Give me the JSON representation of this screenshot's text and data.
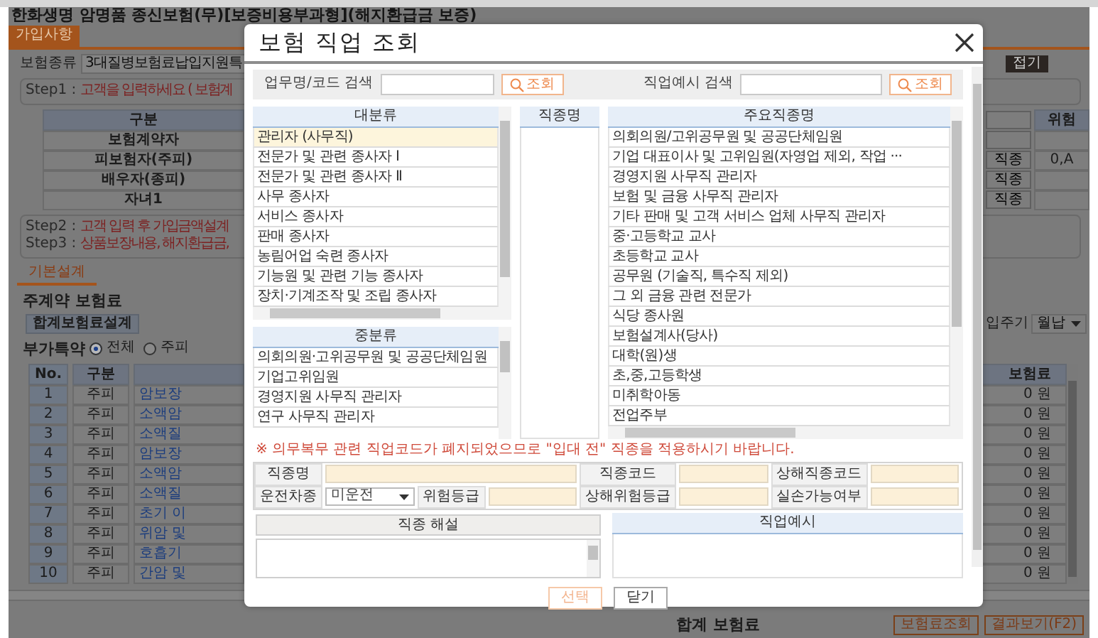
{
  "page": {
    "title": "한화생명 암명품 종신보험(무)[보증비용부과형](해지환급금 보증)",
    "tabs": [
      {
        "label": "가입사항",
        "selected": true
      }
    ],
    "collapse_button": "접기",
    "product": {
      "label": "보험종류",
      "value": "3대질병보험료납입지원특"
    },
    "steps": [
      {
        "label": "Step1 :",
        "text": "고객을 입력하세요 ( 보험계"
      },
      {
        "label": "Step2 :",
        "text": "고객 입력 후 가입금액설계"
      },
      {
        "label": "Step3 :",
        "text": "상품보장내용, 해지환급금,"
      }
    ],
    "insured_table": {
      "columns": [
        "구분",
        "위험"
      ],
      "rows": [
        {
          "label": "보험계약자"
        },
        {
          "label": "피보험자(주피)",
          "job_button": "직종",
          "risk": "0,A"
        },
        {
          "label": "배우자(종피)",
          "job_button": "직종"
        },
        {
          "label": "자녀1",
          "job_button": "직종"
        }
      ]
    },
    "design_tabs": [
      {
        "label": "기본설계",
        "selected": true
      }
    ],
    "main_premium": {
      "title": "주계약 보험료",
      "button": "합계보험료설계"
    },
    "payment_cycle": {
      "label": "입주기",
      "value": "월납"
    },
    "riders": {
      "title": "부가특약",
      "filters": [
        {
          "label": "전체",
          "selected": true
        },
        {
          "label": "주피",
          "selected": false
        }
      ],
      "columns": [
        "No.",
        "구분",
        "보험료"
      ],
      "rows": [
        {
          "no": "1",
          "type": "주피",
          "name": "암보장",
          "premium": "0 원"
        },
        {
          "no": "2",
          "type": "주피",
          "name": "소액암",
          "premium": "0 원"
        },
        {
          "no": "3",
          "type": "주피",
          "name": "소액질",
          "premium": "0 원"
        },
        {
          "no": "4",
          "type": "주피",
          "name": "암보장",
          "premium": "0 원"
        },
        {
          "no": "5",
          "type": "주피",
          "name": "소액암",
          "premium": "0 원"
        },
        {
          "no": "6",
          "type": "주피",
          "name": "소액질",
          "premium": "0 원"
        },
        {
          "no": "7",
          "type": "주피",
          "name": "초기 이",
          "premium": "0 원"
        },
        {
          "no": "8",
          "type": "주피",
          "name": "위암 및",
          "premium": "0 원"
        },
        {
          "no": "9",
          "type": "주피",
          "name": "호흡기",
          "premium": "0 원"
        },
        {
          "no": "10",
          "type": "주피",
          "name": "간암 및",
          "premium": "0 원"
        }
      ]
    },
    "footer": {
      "total_label": "합계 보험료",
      "buttons": [
        "보험료조회",
        "결과보기(F2)"
      ]
    }
  },
  "modal": {
    "title": "보험 직업 조회",
    "searches": [
      {
        "label": "업무명/코드 검색",
        "button": "조회"
      },
      {
        "label": "직업예시 검색",
        "button": "조회"
      }
    ],
    "lists": {
      "major": {
        "header": "대분류",
        "items": [
          {
            "label": "관리자 (사무직)",
            "selected": true
          },
          {
            "label": "전문가 및 관련 종사자 Ⅰ",
            "selected": false
          },
          {
            "label": "전문가 및 관련 종사자 Ⅱ",
            "selected": false
          },
          {
            "label": "사무 종사자",
            "selected": false
          },
          {
            "label": "서비스 종사자",
            "selected": false
          },
          {
            "label": "판매 종사자",
            "selected": false
          },
          {
            "label": "농림어업 숙련 종사자",
            "selected": false
          },
          {
            "label": "기능원 및 관련 기능 종사자",
            "selected": false
          },
          {
            "label": "장치·기계조작 및 조립 종사자",
            "selected": false
          }
        ]
      },
      "middle": {
        "header": "중분류",
        "items": [
          {
            "label": "의회의원·고위공무원 및 공공단체임원",
            "selected": false
          },
          {
            "label": "기업고위임원",
            "selected": false
          },
          {
            "label": "경영지원 사무직 관리자",
            "selected": false
          },
          {
            "label": "연구 사무직 관리자",
            "selected": false
          }
        ]
      },
      "occupation": {
        "header": "직종명"
      },
      "main_jobs": {
        "header": "주요직종명",
        "items": [
          {
            "label": "의회의원/고위공무원 및 공공단체임원",
            "selected": false
          },
          {
            "label": "기업 대표이사 및 고위임원(자영업 제외, 작업 ···",
            "selected": false
          },
          {
            "label": "경영지원 사무직 관리자",
            "selected": false
          },
          {
            "label": "보험 및 금융 사무직 관리자",
            "selected": false
          },
          {
            "label": "기타 판매 및 고객 서비스 업체 사무직 관리자",
            "selected": false
          },
          {
            "label": "중·고등학교 교사",
            "selected": false
          },
          {
            "label": "초등학교 교사",
            "selected": false
          },
          {
            "label": "공무원 (기술직, 특수직 제외)",
            "selected": false
          },
          {
            "label": "그 외 금융 관련 전문가",
            "selected": false
          },
          {
            "label": "식당 종사원",
            "selected": false
          },
          {
            "label": "보험설계사(당사)",
            "selected": false
          },
          {
            "label": "대학(원)생",
            "selected": false
          },
          {
            "label": "초,중,고등학생",
            "selected": false
          },
          {
            "label": "미취학아동",
            "selected": false
          },
          {
            "label": "전업주부",
            "selected": false
          }
        ]
      }
    },
    "notice": "※ 의무복무 관련 직업코드가 폐지되었으므로 \"입대 전\" 직종을 적용하시기 바랍니다.",
    "form_rows": [
      [
        {
          "label": "직종명",
          "kind": "text"
        },
        {
          "label": "직종코드",
          "kind": "text"
        },
        {
          "label": "상해직종코드",
          "kind": "text"
        }
      ],
      [
        {
          "label": "운전차종",
          "kind": "select",
          "value": "미운전"
        },
        {
          "label": "위험등급",
          "kind": "text"
        },
        {
          "label": "상해위험등급",
          "kind": "text"
        },
        {
          "label": "실손가능여부",
          "kind": "text"
        }
      ]
    ],
    "panels": [
      {
        "title": "직종 해설",
        "kind": "textarea"
      },
      {
        "title": "직업예시",
        "kind": "list"
      }
    ],
    "buttons": [
      {
        "label": "선택",
        "disabled": true
      },
      {
        "label": "닫기",
        "disabled": false
      }
    ]
  }
}
